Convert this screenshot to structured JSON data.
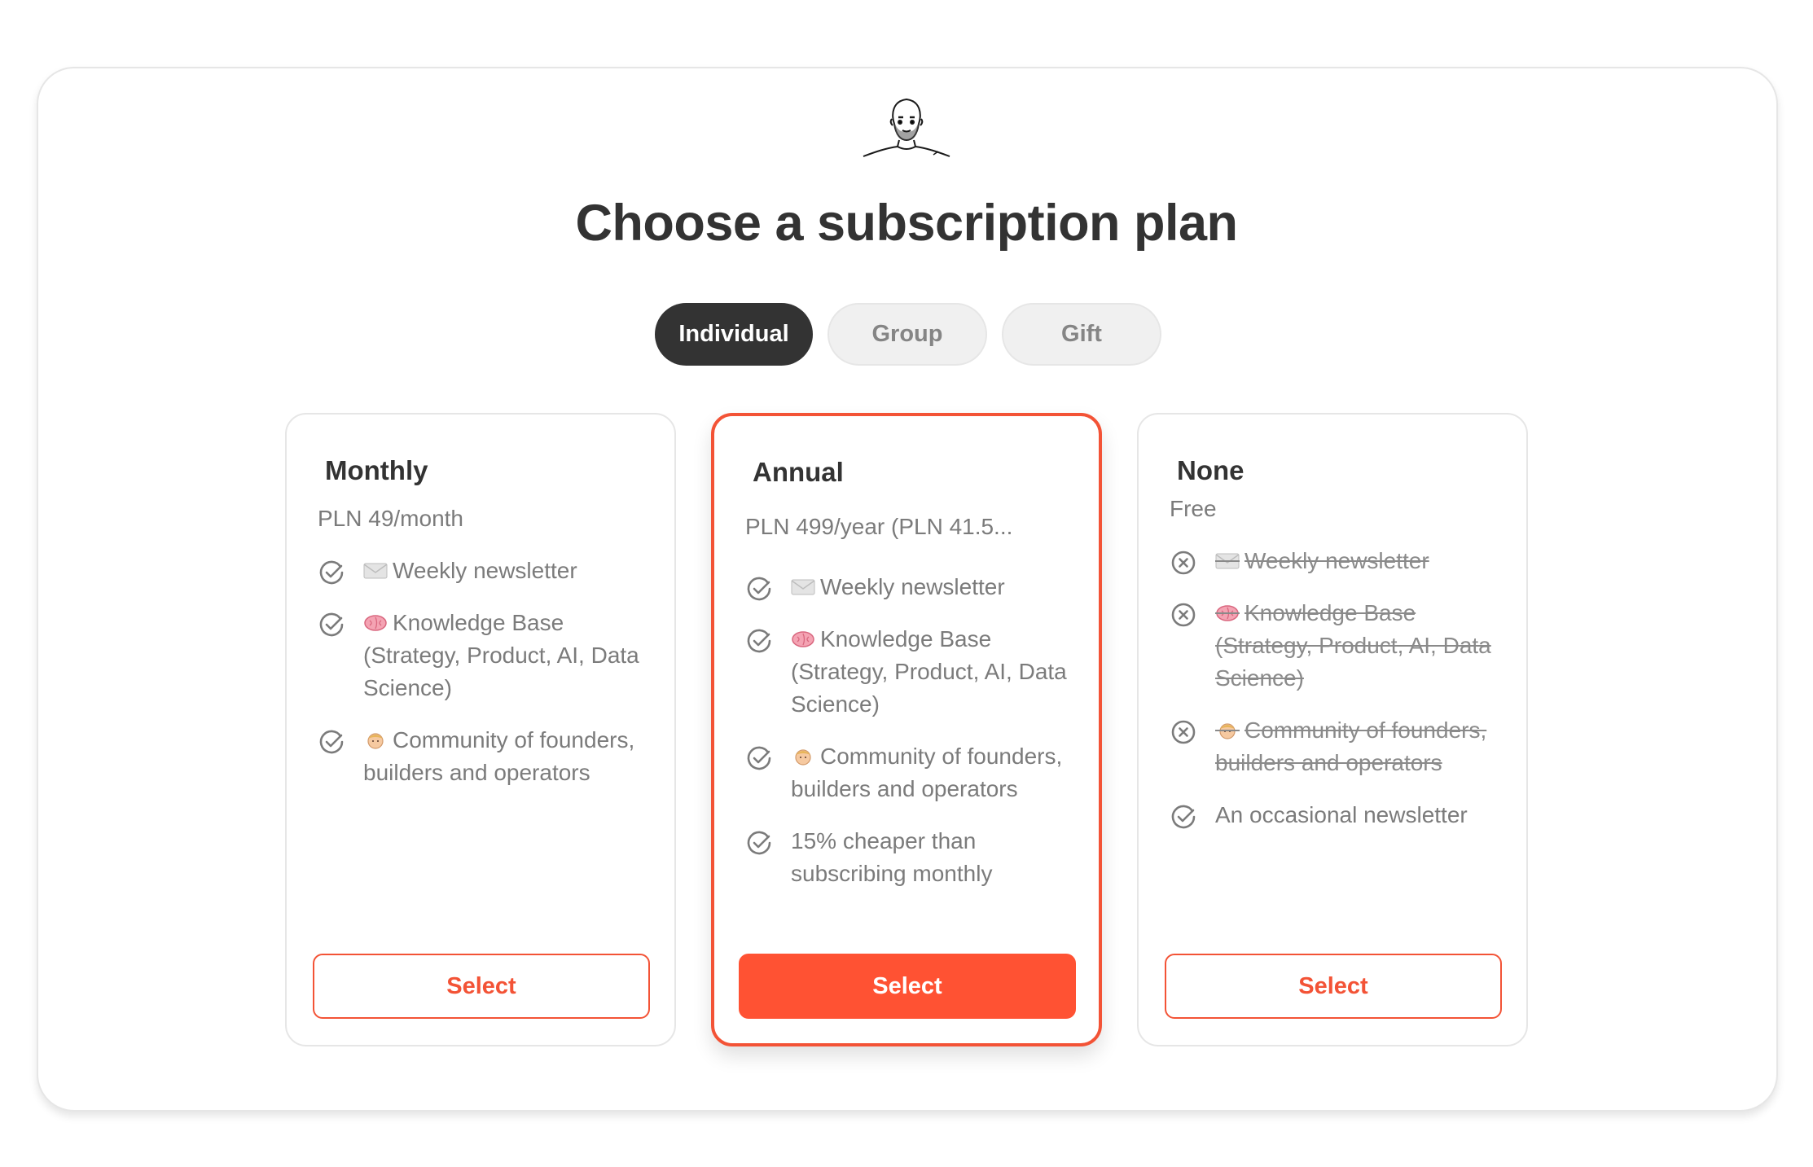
{
  "header": {
    "title": "Choose a subscription plan"
  },
  "tabs": [
    {
      "label": "Individual",
      "active": true
    },
    {
      "label": "Group",
      "active": false
    },
    {
      "label": "Gift",
      "active": false
    }
  ],
  "plans": [
    {
      "name": "Monthly",
      "price": "PLN 49/month",
      "features": [
        {
          "text": "Weekly newsletter",
          "emoji": "envelope-icon",
          "included": true
        },
        {
          "text": "Knowledge Base (Strategy, Product, AI, Data Science)",
          "emoji": "brain-icon",
          "included": true
        },
        {
          "text": "Community of founders, builders and operators",
          "emoji": "person-icon",
          "included": true
        }
      ],
      "button": "Select"
    },
    {
      "name": "Annual",
      "price": "PLN 499/year (PLN 41.5...",
      "features": [
        {
          "text": "Weekly newsletter",
          "emoji": "envelope-icon",
          "included": true
        },
        {
          "text": "Knowledge Base (Strategy, Product, AI, Data Science)",
          "emoji": "brain-icon",
          "included": true
        },
        {
          "text": "Community of founders, builders and operators",
          "emoji": "person-icon",
          "included": true
        },
        {
          "text": "15% cheaper than subscribing monthly",
          "emoji": "",
          "included": true
        }
      ],
      "button": "Select"
    },
    {
      "name": "None",
      "price": "Free",
      "features": [
        {
          "text": "Weekly newsletter",
          "emoji": "envelope-icon",
          "included": false
        },
        {
          "text": "Knowledge Base (Strategy, Product, AI, Data Science)",
          "emoji": "brain-icon",
          "included": false
        },
        {
          "text": "Community of founders, builders and operators",
          "emoji": "person-icon",
          "included": false
        },
        {
          "text": "An occasional newsletter",
          "emoji": "",
          "included": true
        }
      ],
      "button": "Select"
    }
  ],
  "colors": {
    "accent": "#ff5233",
    "accent_border": "#f35336",
    "dark": "#333333",
    "muted": "#7b7b7b"
  }
}
